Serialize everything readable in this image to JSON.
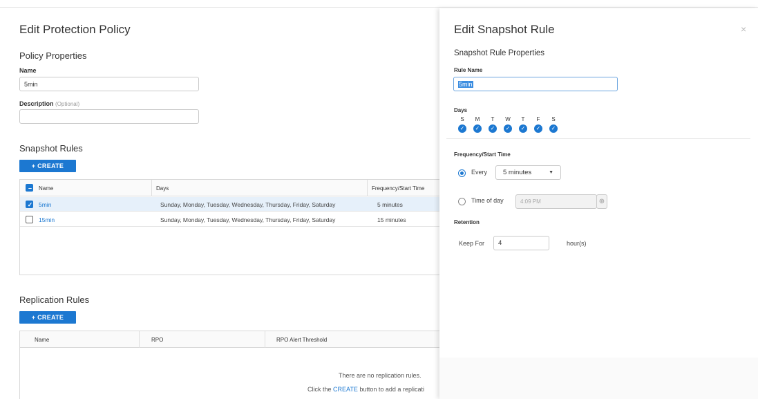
{
  "policy": {
    "title": "Edit Protection Policy",
    "properties_heading": "Policy Properties",
    "name_label": "Name",
    "name_value": "5min",
    "description_label": "Description",
    "description_optional": "(Optional)",
    "description_value": ""
  },
  "snapshot_rules": {
    "heading": "Snapshot Rules",
    "create_label": "+ CREATE",
    "columns": [
      "Name",
      "Days",
      "Frequency/Start Time"
    ],
    "rows": [
      {
        "name": "5min",
        "days": "Sunday, Monday, Tuesday, Wednesday, Thursday, Friday, Saturday",
        "frequency": "5 minutes",
        "selected": true
      },
      {
        "name": "15min",
        "days": "Sunday, Monday, Tuesday, Wednesday, Thursday, Friday, Saturday",
        "frequency": "15 minutes",
        "selected": false
      }
    ]
  },
  "replication_rules": {
    "heading": "Replication Rules",
    "create_label": "+ CREATE",
    "columns": [
      "Name",
      "RPO",
      "RPO Alert Threshold"
    ],
    "empty_text": "There are no replication rules.",
    "hint_prefix": "Click the",
    "hint_link": "CREATE",
    "hint_suffix": "button to add a replicati"
  },
  "snapshot_rule_panel": {
    "title": "Edit Snapshot Rule",
    "close_icon": "close-icon",
    "properties_heading": "Snapshot Rule Properties",
    "rule_name_label": "Rule Name",
    "rule_name_value": "5min",
    "days_label": "Days",
    "days": [
      "S",
      "M",
      "T",
      "W",
      "T",
      "F",
      "S"
    ],
    "frequency_label": "Frequency/Start Time",
    "every_label": "Every",
    "every_value": "5 minutes",
    "time_of_day_label": "Time of day",
    "time_of_day_value": "4:09 PM",
    "retention_label": "Retention",
    "keep_for_label": "Keep For",
    "keep_for_value": "4",
    "keep_for_unit": "hour(s)"
  },
  "colors": {
    "accent": "#1c78d1",
    "selected_row": "#e6f0fa"
  }
}
